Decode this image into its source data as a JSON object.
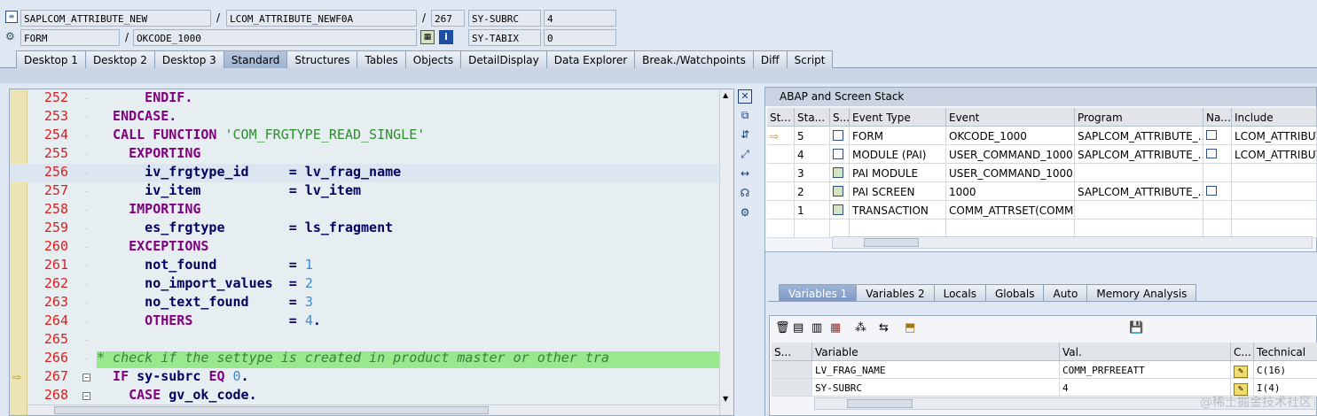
{
  "header": {
    "row1": {
      "program": "SAPLCOM_ATTRIBUTE_NEW",
      "include": "LCOM_ATTRIBUTE_NEWF0A",
      "line": "267",
      "var1_name": "SY-SUBRC",
      "var1_value": "4"
    },
    "row2": {
      "event_type": "FORM",
      "event": "OKCODE_1000",
      "var2_name": "SY-TABIX",
      "var2_value": "0"
    },
    "sep": "/"
  },
  "tabs": [
    "Desktop 1",
    "Desktop 2",
    "Desktop 3",
    "Standard",
    "Structures",
    "Tables",
    "Objects",
    "DetailDisplay",
    "Data Explorer",
    "Break./Watchpoints",
    "Diff",
    "Script"
  ],
  "editor": {
    "lines": [
      {
        "no": "252",
        "parts": [
          [
            "kw",
            "      ENDIF."
          ]
        ]
      },
      {
        "no": "253",
        "parts": [
          [
            "kw",
            "  ENDCASE."
          ]
        ]
      },
      {
        "no": "254",
        "parts": [
          [
            "kw",
            "  CALL FUNCTION "
          ],
          [
            "str",
            "'COM_FRGTYPE_READ_SINGLE'"
          ]
        ]
      },
      {
        "no": "255",
        "parts": [
          [
            "kw",
            "    EXPORTING"
          ]
        ]
      },
      {
        "no": "256",
        "parts": [
          [
            "id",
            "      iv_frgtype_id     = lv_frag_name"
          ]
        ]
      },
      {
        "no": "257",
        "parts": [
          [
            "id",
            "      iv_item           = lv_item"
          ]
        ]
      },
      {
        "no": "258",
        "parts": [
          [
            "kw",
            "    IMPORTING"
          ]
        ]
      },
      {
        "no": "259",
        "parts": [
          [
            "id",
            "      es_frgtype        = ls_fragment"
          ]
        ]
      },
      {
        "no": "260",
        "parts": [
          [
            "kw",
            "    EXCEPTIONS"
          ]
        ]
      },
      {
        "no": "261",
        "parts": [
          [
            "id",
            "      not_found         = "
          ],
          [
            "num",
            "1"
          ]
        ]
      },
      {
        "no": "262",
        "parts": [
          [
            "id",
            "      no_import_values  = "
          ],
          [
            "num",
            "2"
          ]
        ]
      },
      {
        "no": "263",
        "parts": [
          [
            "id",
            "      no_text_found     = "
          ],
          [
            "num",
            "3"
          ]
        ]
      },
      {
        "no": "264",
        "parts": [
          [
            "kw",
            "      OTHERS"
          ],
          [
            "id",
            "            = "
          ],
          [
            "num",
            "4"
          ],
          [
            "id",
            "."
          ]
        ]
      },
      {
        "no": "265",
        "parts": []
      },
      {
        "no": "266",
        "parts": [
          [
            "cm",
            "* check if the settype is created in product master or other tra"
          ]
        ]
      },
      {
        "no": "267",
        "parts": [
          [
            "kw",
            "  IF "
          ],
          [
            "id",
            "sy-subrc "
          ],
          [
            "kw",
            "EQ "
          ],
          [
            "num",
            "0"
          ],
          [
            "id",
            "."
          ]
        ]
      },
      {
        "no": "268",
        "parts": [
          [
            "kw",
            "    CASE "
          ],
          [
            "id",
            "gv_ok_code."
          ]
        ]
      }
    ]
  },
  "stack": {
    "title": "ABAP and Screen Stack",
    "columns": [
      "St...",
      "Sta...",
      "S...",
      "Event Type",
      "Event",
      "Program",
      "Na...",
      "Include"
    ],
    "rows": [
      {
        "st": "⇨",
        "sta": "5",
        "type": "FORM",
        "event": "OKCODE_1000",
        "program": "SAPLCOM_ATTRIBUTE_...",
        "include": "LCOM_ATTRIBUT"
      },
      {
        "st": "",
        "sta": "4",
        "type": "MODULE (PAI)",
        "event": "USER_COMMAND_1000",
        "program": "SAPLCOM_ATTRIBUTE_...",
        "include": "LCOM_ATTRIBUT"
      },
      {
        "st": "",
        "sta": "3",
        "type": "PAI MODULE",
        "event": "USER_COMMAND_1000",
        "program": "",
        "include": ""
      },
      {
        "st": "",
        "sta": "2",
        "type": "PAI SCREEN",
        "event": "1000",
        "program": "SAPLCOM_ATTRIBUTE_...",
        "include": ""
      },
      {
        "st": "",
        "sta": "1",
        "type": "TRANSACTION",
        "event": "COMM_ATTRSET(COMM...",
        "program": "",
        "include": ""
      }
    ]
  },
  "vartabs": [
    "Variables 1",
    "Variables 2",
    "Locals",
    "Globals",
    "Auto",
    "Memory Analysis"
  ],
  "vars": {
    "columns": [
      "S...",
      "Variable",
      "Val.",
      "C...",
      "Technical"
    ],
    "rows": [
      {
        "name": "LV_FRAG_NAME",
        "value": "COMM_PRFREEATT",
        "tech": "C(16)"
      },
      {
        "name": "SY-SUBRC",
        "value": "4",
        "tech": "I(4)"
      }
    ]
  },
  "watermark": "@稀土掘金技术社区"
}
